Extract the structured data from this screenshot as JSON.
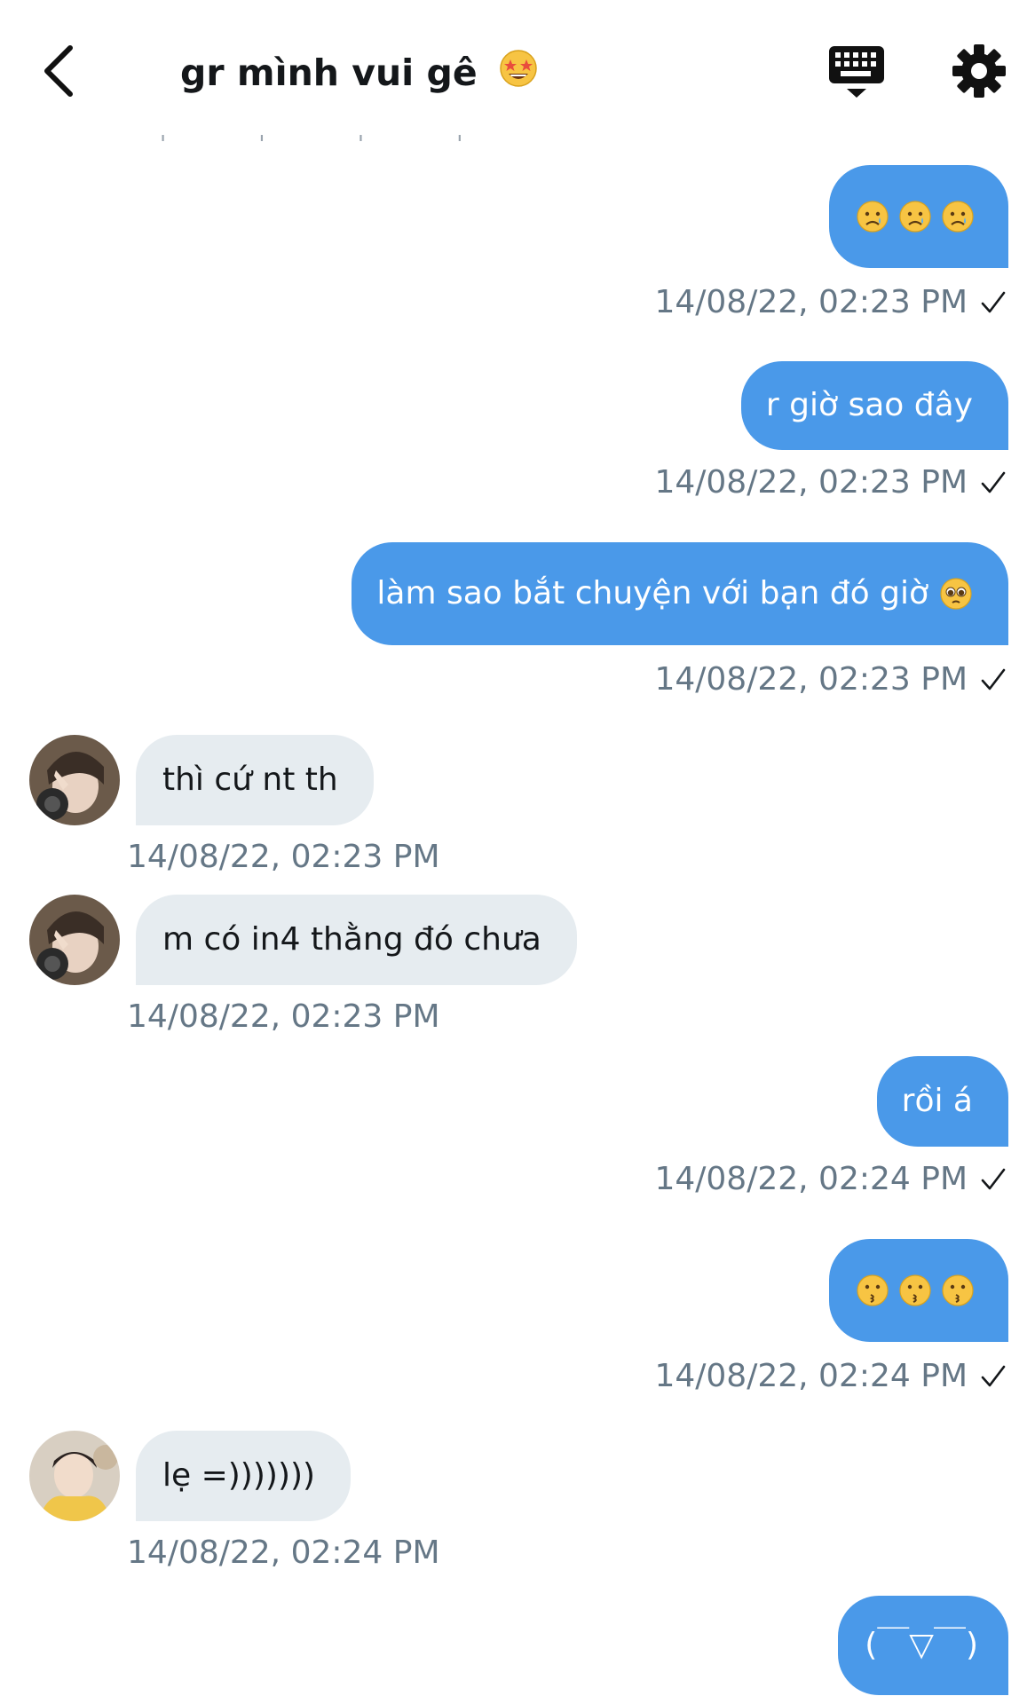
{
  "header": {
    "title": "gr mình vui gê",
    "title_emoji": "star-struck-emoji",
    "back_icon": "chevron-left-icon",
    "keyboard_icon": "keyboard-icon",
    "settings_icon": "gear-icon"
  },
  "colors": {
    "outgoing_bubble": "#4a99e9",
    "incoming_bubble": "#e6ecf0",
    "timestamp": "#657786"
  },
  "messages": [
    {
      "direction": "out",
      "text": "",
      "emojis": [
        "crying-face",
        "crying-face",
        "crying-face"
      ],
      "timestamp": "14/08/22, 02:23 PM",
      "read": true
    },
    {
      "direction": "out",
      "text": "r giờ sao đây",
      "timestamp": "14/08/22, 02:23 PM",
      "read": true
    },
    {
      "direction": "out",
      "text": "làm sao bắt chuyện với bạn đó giờ",
      "emojis": [
        "pleading-face"
      ],
      "timestamp": "14/08/22, 02:23 PM",
      "read": true
    },
    {
      "direction": "in",
      "text": "thì cứ nt th",
      "timestamp": "14/08/22, 02:23 PM"
    },
    {
      "direction": "in",
      "text": "m có in4 thằng đó chưa",
      "timestamp": "14/08/22, 02:23 PM"
    },
    {
      "direction": "out",
      "text": "rồi á",
      "timestamp": "14/08/22, 02:24 PM",
      "read": true
    },
    {
      "direction": "out",
      "text": "",
      "emojis": [
        "kissing-face",
        "kissing-face",
        "kissing-face"
      ],
      "timestamp": "14/08/22, 02:24 PM",
      "read": true
    },
    {
      "direction": "in",
      "text": "lẹ =)))))))",
      "timestamp": "14/08/22, 02:24 PM"
    },
    {
      "direction": "out",
      "text": "(￣▽￣)"
    }
  ]
}
